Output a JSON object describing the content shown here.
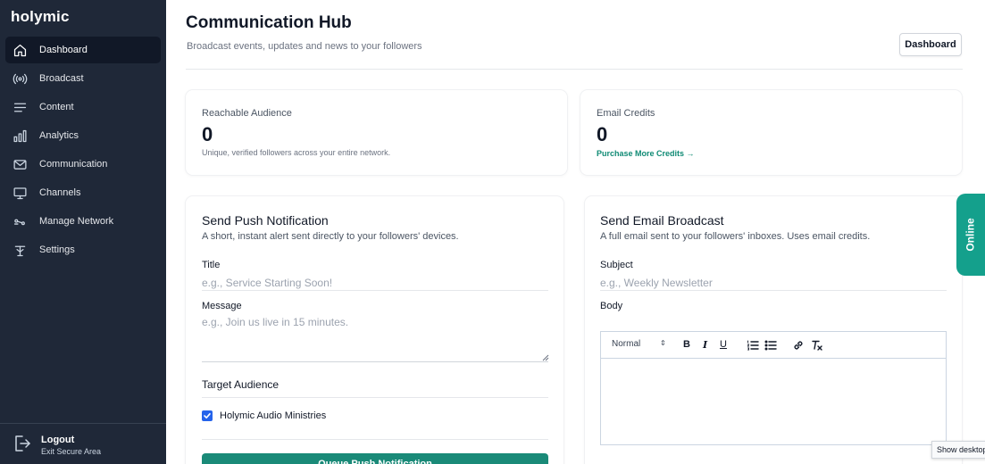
{
  "app": {
    "logo": "holymic"
  },
  "sidebar": {
    "items": [
      {
        "label": "Dashboard",
        "icon": "home-icon",
        "active": true
      },
      {
        "label": "Broadcast",
        "icon": "broadcast-icon"
      },
      {
        "label": "Content",
        "icon": "lines-icon"
      },
      {
        "label": "Analytics",
        "icon": "bar-chart-icon"
      },
      {
        "label": "Communication",
        "icon": "mail-icon"
      },
      {
        "label": "Channels",
        "icon": "monitor-icon"
      },
      {
        "label": "Manage Network",
        "icon": "network-icon"
      },
      {
        "label": "Settings",
        "icon": "settings-icon"
      }
    ],
    "logout": {
      "label": "Logout",
      "sublabel": "Exit Secure Area",
      "icon": "logout-icon"
    }
  },
  "header": {
    "title": "Communication Hub",
    "subtitle": "Broadcast events, updates and news to your followers",
    "dashboard_button": "Dashboard"
  },
  "stats": {
    "audience": {
      "label": "Reachable Audience",
      "value": "0",
      "note": "Unique, verified followers across your entire network."
    },
    "credits": {
      "label": "Email Credits",
      "value": "0",
      "link": "Purchase More Credits →"
    }
  },
  "push": {
    "title": "Send Push Notification",
    "description": "A short, instant alert sent directly to your followers' devices.",
    "title_label": "Title",
    "title_placeholder": "e.g., Service Starting Soon!",
    "message_label": "Message",
    "message_placeholder": "e.g., Join us live in 15 minutes.",
    "audience_title": "Target Audience",
    "audience_option": "Holymic Audio Ministries",
    "audience_checked": true,
    "submit_label": "Queue Push Notification"
  },
  "email": {
    "title": "Send Email Broadcast",
    "description": "A full email sent to your followers' inboxes. Uses email credits.",
    "subject_label": "Subject",
    "subject_placeholder": "e.g., Weekly Newsletter",
    "body_label": "Body",
    "toolbar": {
      "format": "Normal",
      "bold": "B",
      "italic": "I",
      "underline": "U"
    }
  },
  "status_tab": {
    "label": "Online",
    "color": "#14a08c"
  },
  "tooltip": {
    "text": "Show desktop"
  },
  "colors": {
    "sidebar": "#1f2838",
    "accent": "#1a8a78",
    "link": "#0f8a74"
  }
}
